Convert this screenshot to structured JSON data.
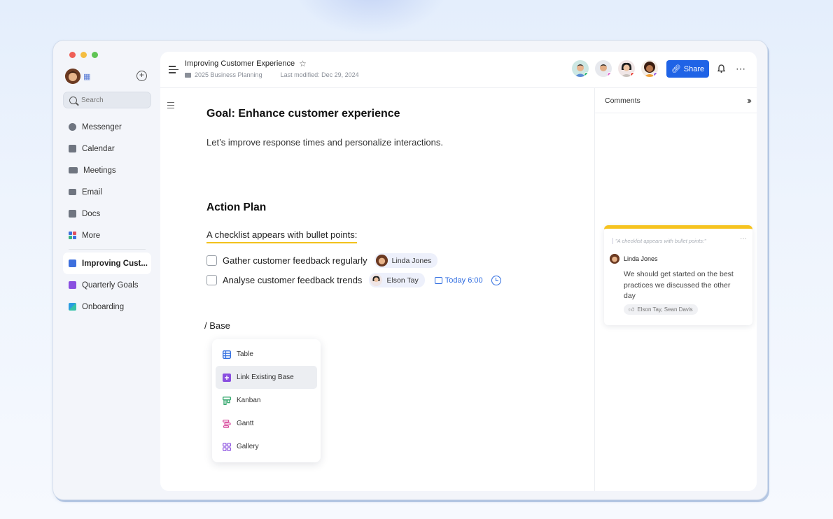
{
  "sidebar": {
    "search_placeholder": "Search",
    "nav": [
      {
        "label": "Messenger"
      },
      {
        "label": "Calendar"
      },
      {
        "label": "Meetings"
      },
      {
        "label": "Email"
      },
      {
        "label": "Docs"
      },
      {
        "label": "More"
      }
    ],
    "docs": [
      {
        "label": "Improving Cust..."
      },
      {
        "label": "Quarterly Goals"
      },
      {
        "label": "Onboarding"
      }
    ]
  },
  "header": {
    "title": "Improving Customer Experience",
    "breadcrumb": "2025 Business Planning",
    "last_modified": "Last modified: Dec 29, 2024",
    "share_label": "Share"
  },
  "document": {
    "goal_heading": "Goal: Enhance customer experience",
    "intro": "Let’s improve response times and personalize interactions.",
    "plan_heading": "Action Plan",
    "checklist_lead": "A checklist appears with bullet points:",
    "tasks": [
      {
        "text": "Gather customer feedback regularly",
        "assignee": "Linda Jones"
      },
      {
        "text": "Analyse customer feedback trends",
        "assignee": "Elson Tay",
        "due": "Today 6:00"
      }
    ],
    "slash_command": "/ Base",
    "menu": [
      {
        "label": "Table"
      },
      {
        "label": "Link Existing Base"
      },
      {
        "label": "Kanban"
      },
      {
        "label": "Gantt"
      },
      {
        "label": "Gallery"
      }
    ]
  },
  "comments": {
    "title": "Comments",
    "card": {
      "quote": "\"A checklist appears with bullet points:\"",
      "author": "Linda Jones",
      "body": "We should get started on the best practices we discussed the other day",
      "reactions": "Elson Tay, Sean Davis"
    }
  },
  "colors": {
    "accent": "#1f63e6",
    "highlight": "#f2c21d"
  }
}
